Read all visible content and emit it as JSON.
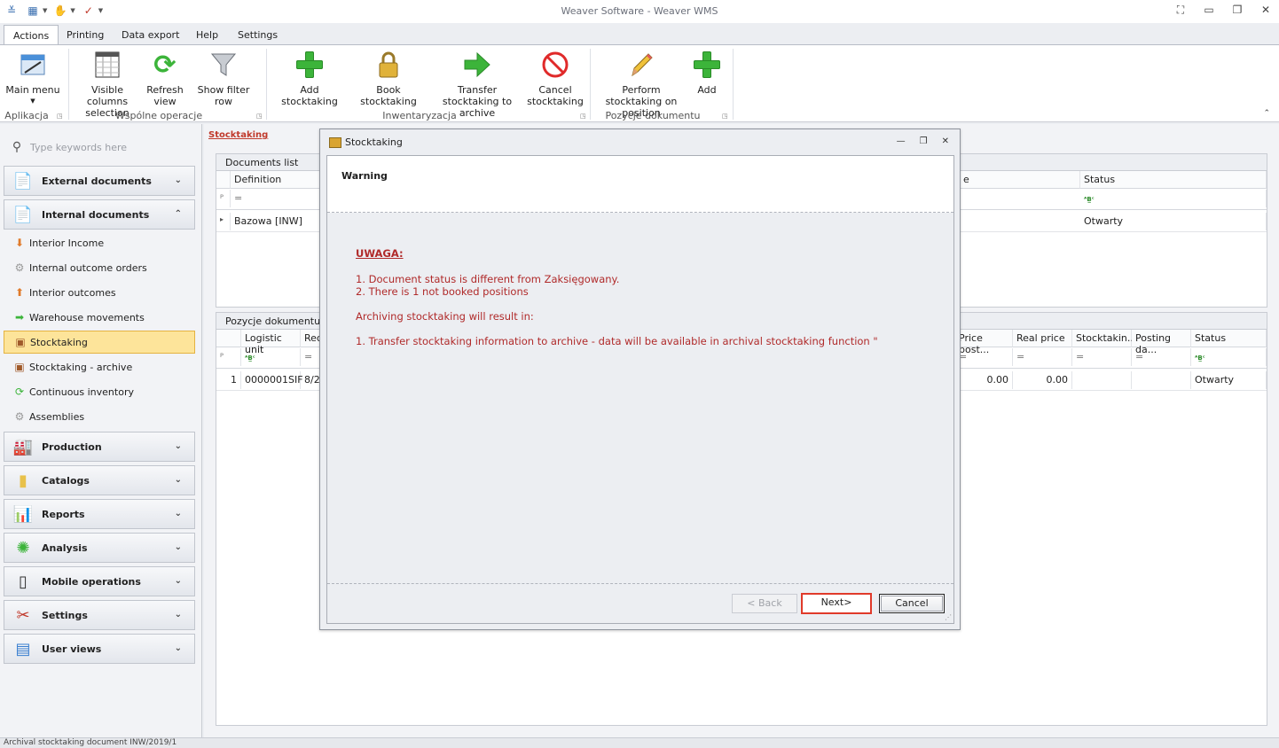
{
  "window": {
    "title": "Weaver Software - Weaver WMS"
  },
  "tabs": [
    "Actions",
    "Printing",
    "Data export",
    "Help",
    "Settings"
  ],
  "ribbon": {
    "main_menu": "Main menu",
    "visible_columns": "Visible columns selection",
    "refresh_view": "Refresh view",
    "show_filter_row": "Show filter row",
    "add_stocktaking": "Add stocktaking",
    "book_stocktaking": "Book stocktaking",
    "transfer_stocktaking": "Transfer stocktaking to archive",
    "cancel_stocktaking": "Cancel stocktaking",
    "perform_stocktaking": "Perform stocktaking on position",
    "add": "Add",
    "groups": [
      "Aplikacja",
      "Wspólne operacje",
      "Inwentaryzacja",
      "Pozycje dokumentu"
    ]
  },
  "sidebar": {
    "search_placeholder": "Type keywords here",
    "groups": {
      "external": "External documents",
      "internal": "Internal documents",
      "production": "Production",
      "catalogs": "Catalogs",
      "reports": "Reports",
      "analysis": "Analysis",
      "mobile": "Mobile operations",
      "settings": "Settings",
      "user_views": "User views"
    },
    "items": [
      "Interior Income",
      "Internal outcome orders",
      "Interior outcomes",
      "Warehouse movements",
      "Stocktaking",
      "Stocktaking - archive",
      "Continuous inventory",
      "Assemblies"
    ]
  },
  "main": {
    "breadcrumb": "Stocktaking",
    "documents_list": {
      "title": "Documents list",
      "col_definition": "Definition",
      "col_e": "e",
      "col_status": "Status",
      "row_definition": "Bazowa [INW]",
      "row_status": "Otwarty"
    },
    "positions": {
      "title": "Pozycje dokumentu: II",
      "col_logistic": "Logistic unit",
      "col_rec": "Rec",
      "col_price_post": "Price post...",
      "col_real_price": "Real price",
      "col_stocktakin": "Stocktakin...",
      "col_posting": "Posting da...",
      "col_status": "Status",
      "row_num": "1",
      "row_logistic": "0000001SIF",
      "row_rec": "8/2",
      "row_price_post": "0.00",
      "row_real_price": "0.00",
      "row_status": "Otwarty"
    }
  },
  "dialog": {
    "title": "Stocktaking",
    "header": "Warning",
    "uwaga": "UWAGA:",
    "line1": "1. Document status is different from Zaksięgowany.",
    "line2": "2. There is 1 not booked positions",
    "line3": "Archiving stocktaking will result in:",
    "line4": "1. Transfer stocktaking information to archive - data will be available in archival stocktaking function \"",
    "back": "< Back",
    "next": "Next>",
    "cancel": "Cancel"
  },
  "statusbar": {
    "text": "Archival stocktaking document INW/2019/1"
  }
}
